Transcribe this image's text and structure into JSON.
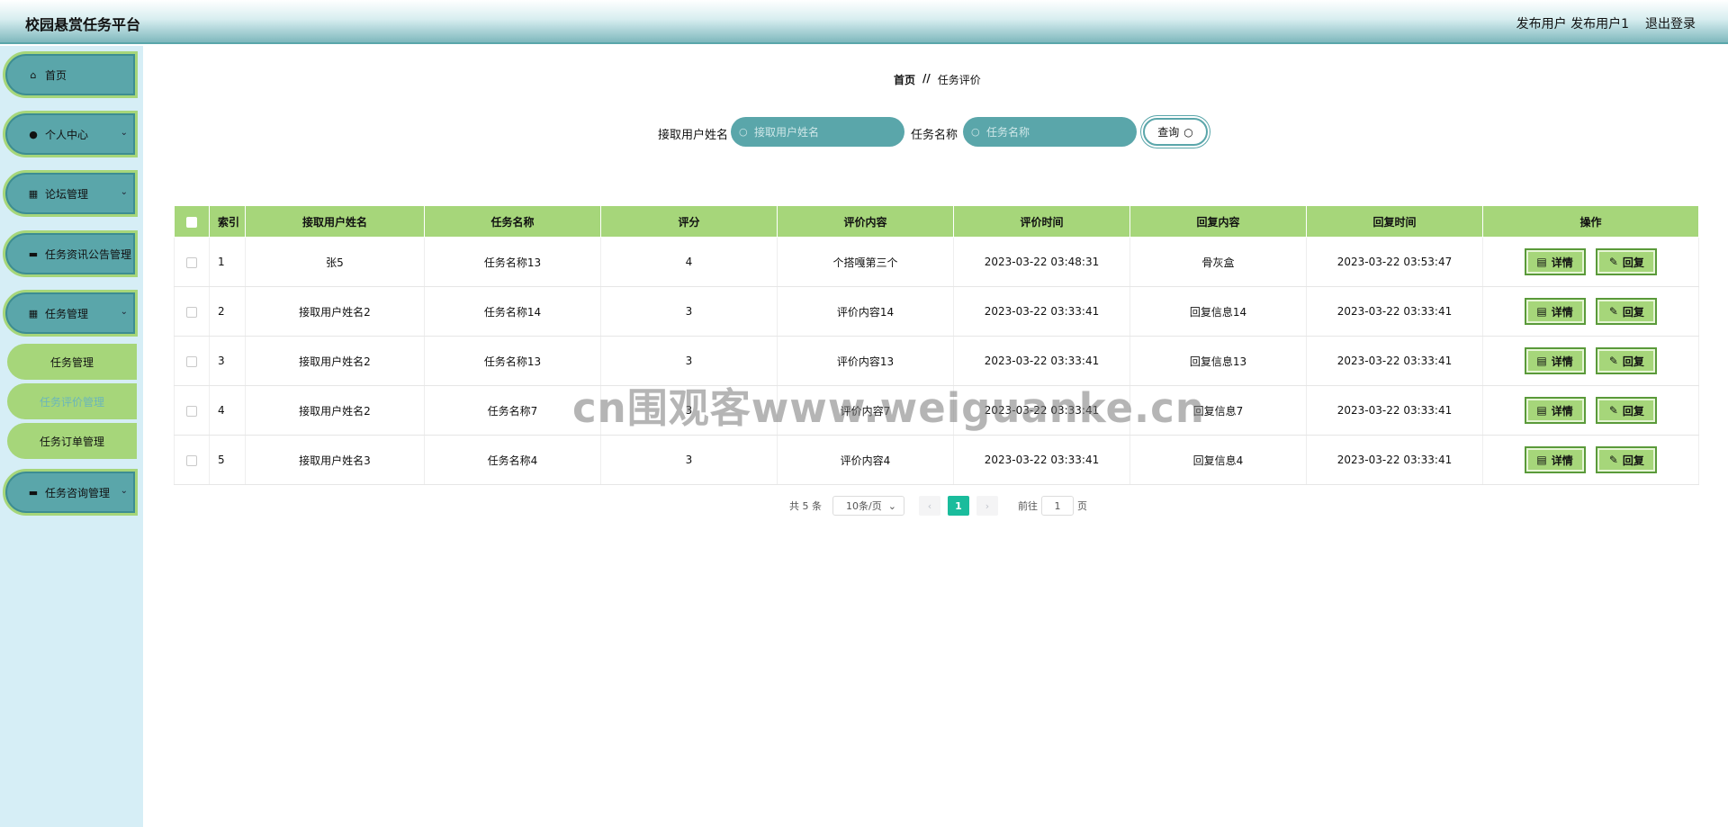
{
  "header": {
    "title": "校园悬赏任务平台",
    "user_role": "发布用户",
    "user_name": "发布用户1",
    "logout": "退出登录"
  },
  "sidebar": {
    "items": [
      {
        "label": "首页",
        "icon": "home-icon"
      },
      {
        "label": "个人中心",
        "icon": "user-icon"
      },
      {
        "label": "论坛管理",
        "icon": "grid-icon"
      },
      {
        "label": "任务资讯公告管理",
        "icon": "monitor-icon"
      },
      {
        "label": "任务管理",
        "icon": "grid-icon"
      },
      {
        "label": "任务咨询管理",
        "icon": "monitor-icon"
      }
    ],
    "sub_items": [
      {
        "label": "任务管理"
      },
      {
        "label": "任务评价管理",
        "active": true
      },
      {
        "label": "任务订单管理"
      }
    ]
  },
  "breadcrumb": {
    "home": "首页",
    "separator": "//",
    "current": "任务评价"
  },
  "search": {
    "user_label": "接取用户姓名",
    "user_placeholder": "接取用户姓名",
    "task_label": "任务名称",
    "task_placeholder": "任务名称",
    "button": "查询"
  },
  "table": {
    "headers": [
      "索引",
      "接取用户姓名",
      "任务名称",
      "评分",
      "评价内容",
      "评价时间",
      "回复内容",
      "回复时间",
      "操作"
    ],
    "rows": [
      {
        "index": "1",
        "user": "张5",
        "task": "任务名称13",
        "score": "4",
        "content": "个搭嘎第三个",
        "time": "2023-03-22 03:48:31",
        "reply": "骨灰盒",
        "reply_time": "2023-03-22 03:53:47"
      },
      {
        "index": "2",
        "user": "接取用户姓名2",
        "task": "任务名称14",
        "score": "3",
        "content": "评价内容14",
        "time": "2023-03-22 03:33:41",
        "reply": "回复信息14",
        "reply_time": "2023-03-22 03:33:41"
      },
      {
        "index": "3",
        "user": "接取用户姓名2",
        "task": "任务名称13",
        "score": "3",
        "content": "评价内容13",
        "time": "2023-03-22 03:33:41",
        "reply": "回复信息13",
        "reply_time": "2023-03-22 03:33:41"
      },
      {
        "index": "4",
        "user": "接取用户姓名2",
        "task": "任务名称7",
        "score": "3",
        "content": "评价内容7",
        "time": "2023-03-22 03:33:41",
        "reply": "回复信息7",
        "reply_time": "2023-03-22 03:33:41"
      },
      {
        "index": "5",
        "user": "接取用户姓名3",
        "task": "任务名称4",
        "score": "3",
        "content": "评价内容4",
        "time": "2023-03-22 03:33:41",
        "reply": "回复信息4",
        "reply_time": "2023-03-22 03:33:41"
      }
    ],
    "detail_btn": "详情",
    "reply_btn": "回复"
  },
  "pagination": {
    "total": "共 5 条",
    "page_size": "10条/页",
    "current_page": "1",
    "jump_label": "前往",
    "jump_value": "1",
    "page_unit": "页"
  },
  "watermark": "cn围观客www.weiguanke.cn"
}
